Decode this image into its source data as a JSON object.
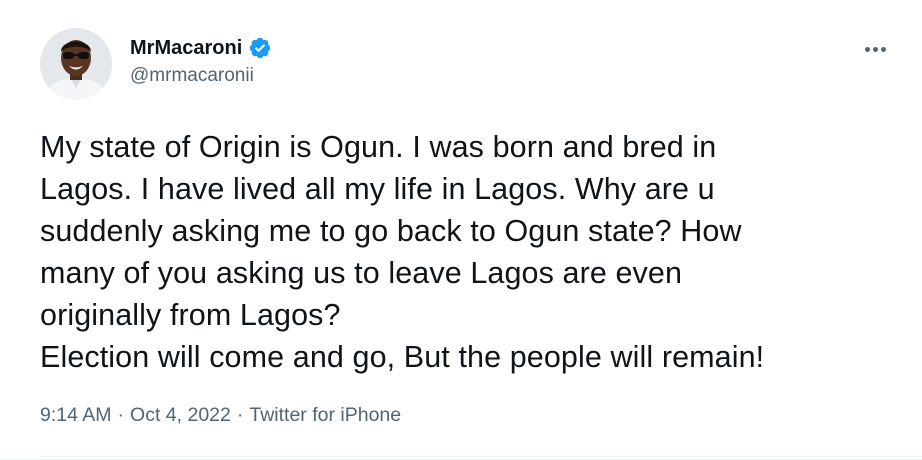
{
  "author": {
    "display_name": "MrMacaroni",
    "handle": "@mrmacaronii",
    "verified": true
  },
  "more_icon": "more-horizontal-icon",
  "tweet": {
    "text": "My state of Origin is Ogun. I was born and bred in\nLagos. I have lived all my life in Lagos. Why are u\nsuddenly asking me to go back to Ogun state? How\nmany of you asking us to leave Lagos are even\noriginally from Lagos?\nElection will come and go, But the people will remain!"
  },
  "meta": {
    "time": "9:14 AM",
    "separator": "·",
    "date": "Oct 4, 2022",
    "source": "Twitter for iPhone"
  },
  "colors": {
    "text_primary": "#0f1419",
    "text_secondary": "#536471",
    "verified_blue": "#1d9bf0",
    "divider": "#eff3f4"
  }
}
